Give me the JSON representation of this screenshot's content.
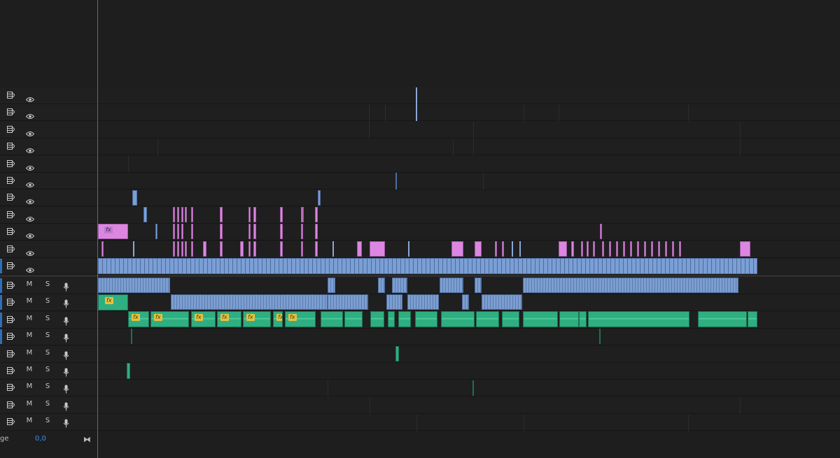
{
  "colors": {
    "background": "#1e1e1e",
    "playhead": "#3b6fd0",
    "video_blue": "#7b9fd5",
    "video_pink": "#dc86e1",
    "audio_green": "#2fae82",
    "fx_badge": "#e7c23f",
    "value_blue": "#3d8ff0"
  },
  "video_tracks": [
    {
      "id": "V11",
      "icons": [
        "sync-lock-icon",
        "eye-icon"
      ]
    },
    {
      "id": "V10",
      "icons": [
        "sync-lock-icon",
        "eye-icon"
      ]
    },
    {
      "id": "V9",
      "icons": [
        "sync-lock-icon",
        "eye-icon"
      ]
    },
    {
      "id": "V8",
      "icons": [
        "sync-lock-icon",
        "eye-icon"
      ]
    },
    {
      "id": "V7",
      "icons": [
        "sync-lock-icon",
        "eye-icon"
      ]
    },
    {
      "id": "V6",
      "icons": [
        "sync-lock-icon",
        "eye-icon"
      ]
    },
    {
      "id": "V5",
      "icons": [
        "sync-lock-icon",
        "eye-icon"
      ]
    },
    {
      "id": "V4",
      "icons": [
        "sync-lock-icon",
        "eye-icon"
      ]
    },
    {
      "id": "V3",
      "icons": [
        "sync-lock-icon",
        "eye-icon"
      ]
    },
    {
      "id": "V2",
      "icons": [
        "sync-lock-icon",
        "eye-icon"
      ]
    },
    {
      "id": "V1",
      "icons": [
        "sync-lock-icon",
        "eye-icon"
      ],
      "targeted": true
    }
  ],
  "audio_tracks": [
    {
      "id": "A1",
      "mute": "M",
      "solo": "S",
      "targeted": true
    },
    {
      "id": "A2",
      "mute": "M",
      "solo": "S",
      "targeted": true
    },
    {
      "id": "A3",
      "mute": "M",
      "solo": "S",
      "targeted": true
    },
    {
      "id": "A4",
      "mute": "M",
      "solo": "S",
      "targeted": true
    },
    {
      "id": "A5",
      "mute": "M",
      "solo": "S"
    },
    {
      "id": "A6",
      "mute": "M",
      "solo": "S"
    },
    {
      "id": "A7",
      "mute": "M",
      "solo": "S"
    },
    {
      "id": "A8",
      "mute": "M",
      "solo": "S"
    },
    {
      "id": "A9",
      "mute": "M",
      "solo": "S"
    }
  ],
  "mix": {
    "label": "ge",
    "value": "0,0",
    "icon": "bowtie-icon"
  },
  "fx_label": "fx"
}
